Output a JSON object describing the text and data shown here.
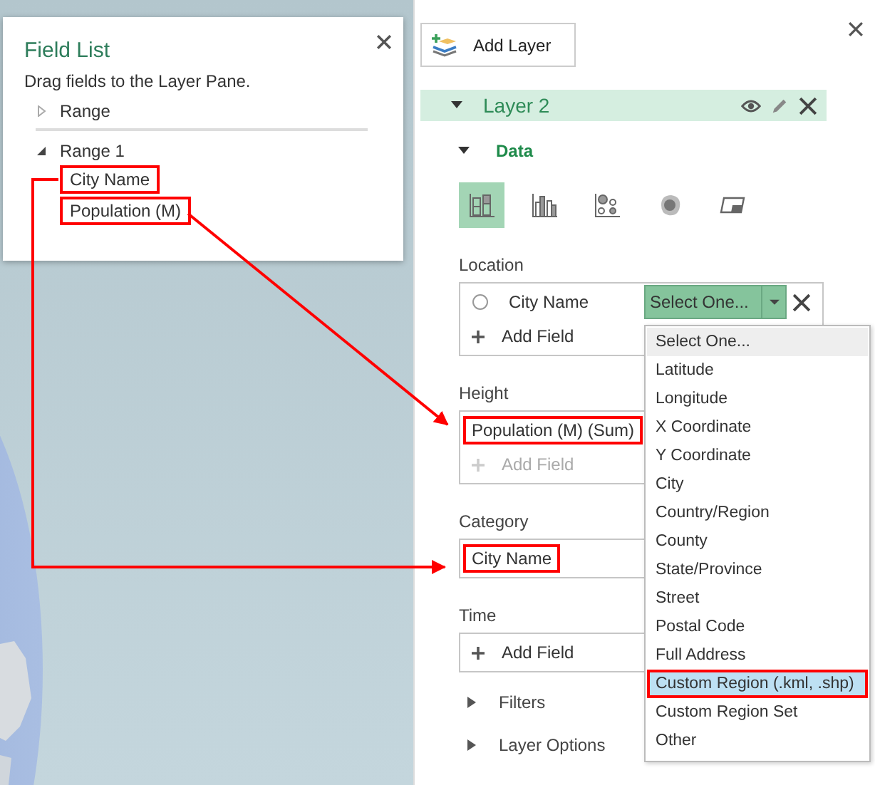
{
  "field_list": {
    "title": "Field List",
    "instruction": "Drag fields to the Layer Pane.",
    "tree": [
      {
        "label": "Range",
        "expanded": false
      },
      {
        "label": "Range 1",
        "expanded": true,
        "children": [
          {
            "label": "City Name",
            "highlighted": true
          },
          {
            "label": "Population (M)",
            "highlighted": true
          }
        ]
      }
    ]
  },
  "layer_pane": {
    "add_layer": "Add Layer",
    "layer": {
      "name": "Layer 2",
      "expanded": true
    },
    "data_section": {
      "label": "Data",
      "expanded": true
    },
    "visualizations": [
      {
        "kind": "stacked-column",
        "selected": true
      },
      {
        "kind": "clustered-column",
        "selected": false
      },
      {
        "kind": "bubble",
        "selected": false
      },
      {
        "kind": "heat-map",
        "selected": false
      },
      {
        "kind": "region",
        "selected": false
      }
    ],
    "sections": [
      {
        "label": "Location",
        "fields": [
          {
            "kind": "location",
            "checked": false,
            "name": "City Name",
            "geo_type": "Select One...",
            "highlighted": false
          }
        ],
        "add_field": {
          "label": "Add Field",
          "disabled": false
        }
      },
      {
        "label": "Height",
        "fields": [
          {
            "kind": "plain",
            "name": "Population (M) (Sum)",
            "highlighted": true
          }
        ],
        "add_field": {
          "label": "Add Field",
          "disabled": true
        }
      },
      {
        "label": "Category",
        "fields": [
          {
            "kind": "plain",
            "name": "City Name",
            "highlighted": true
          }
        ]
      },
      {
        "label": "Time",
        "add_field": {
          "label": "Add Field",
          "disabled": false
        }
      }
    ],
    "collapsed_sections": [
      {
        "label": "Filters",
        "expanded": false
      },
      {
        "label": "Layer Options",
        "expanded": false
      }
    ],
    "geo_dropdown": [
      {
        "label": "Select One...",
        "current": true,
        "selected": false,
        "highlighted": false
      },
      {
        "label": "Latitude",
        "current": false,
        "selected": false,
        "highlighted": false
      },
      {
        "label": "Longitude",
        "current": false,
        "selected": false,
        "highlighted": false
      },
      {
        "label": "X Coordinate",
        "current": false,
        "selected": false,
        "highlighted": false
      },
      {
        "label": "Y Coordinate",
        "current": false,
        "selected": false,
        "highlighted": false
      },
      {
        "label": "City",
        "current": false,
        "selected": false,
        "highlighted": false
      },
      {
        "label": "Country/Region",
        "current": false,
        "selected": false,
        "highlighted": false
      },
      {
        "label": "County",
        "current": false,
        "selected": false,
        "highlighted": false
      },
      {
        "label": "State/Province",
        "current": false,
        "selected": false,
        "highlighted": false
      },
      {
        "label": "Street",
        "current": false,
        "selected": false,
        "highlighted": false
      },
      {
        "label": "Postal Code",
        "current": false,
        "selected": false,
        "highlighted": false
      },
      {
        "label": "Full Address",
        "current": false,
        "selected": false,
        "highlighted": false
      },
      {
        "label": "Custom Region (.kml, .shp)",
        "current": false,
        "selected": true,
        "highlighted": true
      },
      {
        "label": "Custom Region Set",
        "current": false,
        "selected": false,
        "highlighted": false
      },
      {
        "label": "Other",
        "current": false,
        "selected": false,
        "highlighted": false
      }
    ]
  }
}
